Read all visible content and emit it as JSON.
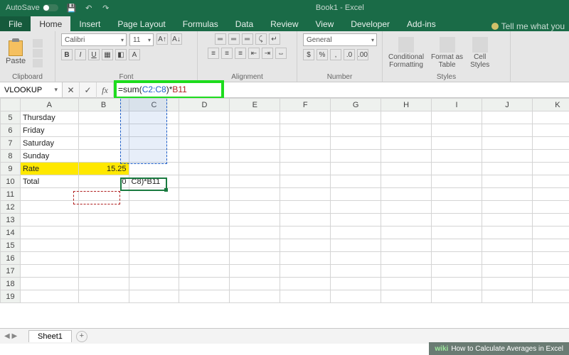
{
  "titlebar": {
    "autosave": "AutoSave",
    "title": "Book1 - Excel"
  },
  "tabs": {
    "file": "File",
    "home": "Home",
    "insert": "Insert",
    "pagelayout": "Page Layout",
    "formulas": "Formulas",
    "data": "Data",
    "review": "Review",
    "view": "View",
    "developer": "Developer",
    "addins": "Add-ins",
    "tell": "Tell me what you"
  },
  "ribbon": {
    "paste": "Paste",
    "font_name": "Calibri",
    "font_size": "11",
    "number_format": "General",
    "group_clipboard": "Clipboard",
    "group_font": "Font",
    "group_alignment": "Alignment",
    "group_number": "Number",
    "group_styles": "Styles",
    "cond_fmt": "Conditional\nFormatting",
    "fmt_table": "Format as\nTable",
    "cell_styles": "Cell\nStyles"
  },
  "namebox": "VLOOKUP",
  "formula": {
    "prefix": "=sum(",
    "ref1": "C2:C8",
    "mid": ")*",
    "ref2": "B11"
  },
  "columns": [
    "A",
    "B",
    "C",
    "D",
    "E",
    "F",
    "G",
    "H",
    "I",
    "J",
    "K"
  ],
  "rows": [
    {
      "n": 5,
      "A": "Thursday"
    },
    {
      "n": 6,
      "A": "Friday"
    },
    {
      "n": 7,
      "A": "Saturday"
    },
    {
      "n": 8,
      "A": "Sunday"
    },
    {
      "n": 9,
      "A": "Rate",
      "B": "15.25",
      "hl": true
    },
    {
      "n": 10,
      "A": "Total",
      "B": "0",
      "C": "C8)*B11"
    },
    {
      "n": 11
    },
    {
      "n": 12
    },
    {
      "n": 13
    },
    {
      "n": 14
    },
    {
      "n": 15
    },
    {
      "n": 16
    },
    {
      "n": 17
    },
    {
      "n": 18
    },
    {
      "n": 19
    }
  ],
  "sheet": {
    "name": "Sheet1"
  },
  "wikihow": {
    "brand": "wiki",
    "rest": "How to Calculate Averages in Excel"
  }
}
